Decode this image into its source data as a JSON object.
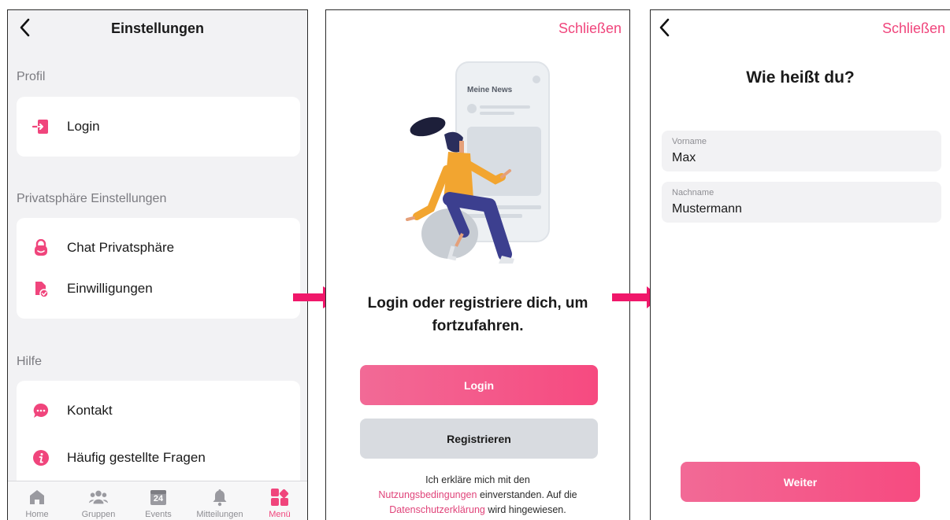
{
  "screen1": {
    "title": "Einstellungen",
    "profile_section": "Profil",
    "login_item": "Login",
    "privacy_section": "Privatsphäre Einstellungen",
    "chat_privacy_item": "Chat Privatsphäre",
    "consents_item": "Einwilligungen",
    "help_section": "Hilfe",
    "contact_item": "Kontakt",
    "faq_item": "Häufig gestellte Fragen",
    "tabs": [
      {
        "label": "Home",
        "icon": "home-icon"
      },
      {
        "label": "Gruppen",
        "icon": "groups-icon"
      },
      {
        "label": "Events",
        "icon": "calendar-icon",
        "day": "24"
      },
      {
        "label": "Mitteilungen",
        "icon": "bell-icon"
      },
      {
        "label": "Menü",
        "icon": "menu-grid-icon",
        "active": true
      }
    ]
  },
  "screen2": {
    "close_label": "Schließen",
    "illustration_text": "Meine News",
    "heading": "Login oder registriere dich, um fortzufahren.",
    "login_button": "Login",
    "register_button": "Registrieren",
    "legal_prefix": "Ich erkläre mich mit den",
    "terms_link": "Nutzungsbedingungen",
    "legal_middle": "einverstanden. Auf die",
    "privacy_link": "Datenschutzerklärung",
    "legal_suffix": "wird hingewiesen."
  },
  "screen3": {
    "close_label": "Schließen",
    "heading": "Wie heißt du?",
    "first_name_label": "Vorname",
    "first_name_value": "Max",
    "last_name_label": "Nachname",
    "last_name_value": "Mustermann",
    "continue_button": "Weiter"
  },
  "colors": {
    "accent": "#f0457c",
    "flow_arrow": "#f0176a",
    "button_gray": "#d8dbe0",
    "background_gray": "#f2f2f4"
  }
}
